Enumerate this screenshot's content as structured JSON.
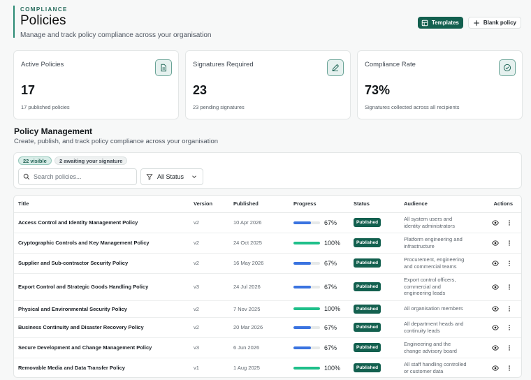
{
  "header": {
    "eyebrow": "COMPLIANCE",
    "title": "Policies",
    "subtitle": "Manage and track policy compliance across your organisation"
  },
  "actions": {
    "templates_label": "Templates",
    "blank_label": "Blank policy"
  },
  "cards": [
    {
      "label": "Active Policies",
      "value": "17",
      "note": "17 published policies",
      "icon": "document-icon"
    },
    {
      "label": "Signatures Required",
      "value": "23",
      "note": "23 pending signatures",
      "icon": "pen-icon"
    },
    {
      "label": "Compliance Rate",
      "value": "73%",
      "note": "Signatures collected across all recipients",
      "icon": "check-circle-icon"
    }
  ],
  "section": {
    "title": "Policy Management",
    "subtitle": "Create, publish, and track policy compliance across your organisation"
  },
  "filters": {
    "visible_chip": "22 visible",
    "await_chip": "2 awaiting your signature",
    "search_placeholder": "Search policies...",
    "status_value": "All Status"
  },
  "table": {
    "columns": [
      "Title",
      "Version",
      "Published",
      "Progress",
      "Status",
      "Audience",
      "Actions"
    ],
    "rows": [
      {
        "title": "Access Control and Identity Management Policy",
        "version": "v2",
        "published": "10 Apr 2026",
        "progress": 67,
        "progress_label": "67%",
        "status": "Published",
        "audience": "All system users and identity administrators"
      },
      {
        "title": "Cryptographic Controls and Key Management Policy",
        "version": "v2",
        "published": "24 Oct 2025",
        "progress": 100,
        "progress_label": "100%",
        "status": "Published",
        "audience": "Platform engineering and infrastructure"
      },
      {
        "title": "Supplier and Sub-contractor Security Policy",
        "version": "v2",
        "published": "16 May 2026",
        "progress": 67,
        "progress_label": "67%",
        "status": "Published",
        "audience": "Procurement, engineering and commercial teams"
      },
      {
        "title": "Export Control and Strategic Goods Handling Policy",
        "version": "v3",
        "published": "24 Jul 2026",
        "progress": 67,
        "progress_label": "67%",
        "status": "Published",
        "audience": "Export control officers, commercial and engineering leads"
      },
      {
        "title": "Physical and Environmental Security Policy",
        "version": "v2",
        "published": "7 Nov 2025",
        "progress": 100,
        "progress_label": "100%",
        "status": "Published",
        "audience": "All organisation members"
      },
      {
        "title": "Business Continuity and Disaster Recovery Policy",
        "version": "v2",
        "published": "20 Mar 2026",
        "progress": 67,
        "progress_label": "67%",
        "status": "Published",
        "audience": "All department heads and continuity leads"
      },
      {
        "title": "Secure Development and Change Management Policy",
        "version": "v3",
        "published": "6 Jun 2026",
        "progress": 67,
        "progress_label": "67%",
        "status": "Published",
        "audience": "Engineering and the change advisory board"
      },
      {
        "title": "Removable Media and Data Transfer Policy",
        "version": "v1",
        "published": "1 Aug 2025",
        "progress": 100,
        "progress_label": "100%",
        "status": "Published",
        "audience": "All staff handling controlled or customer data"
      }
    ]
  },
  "colors": {
    "accent": "#13604f",
    "progress_partial": "#3a73e0",
    "progress_complete": "#1fbf8a"
  }
}
